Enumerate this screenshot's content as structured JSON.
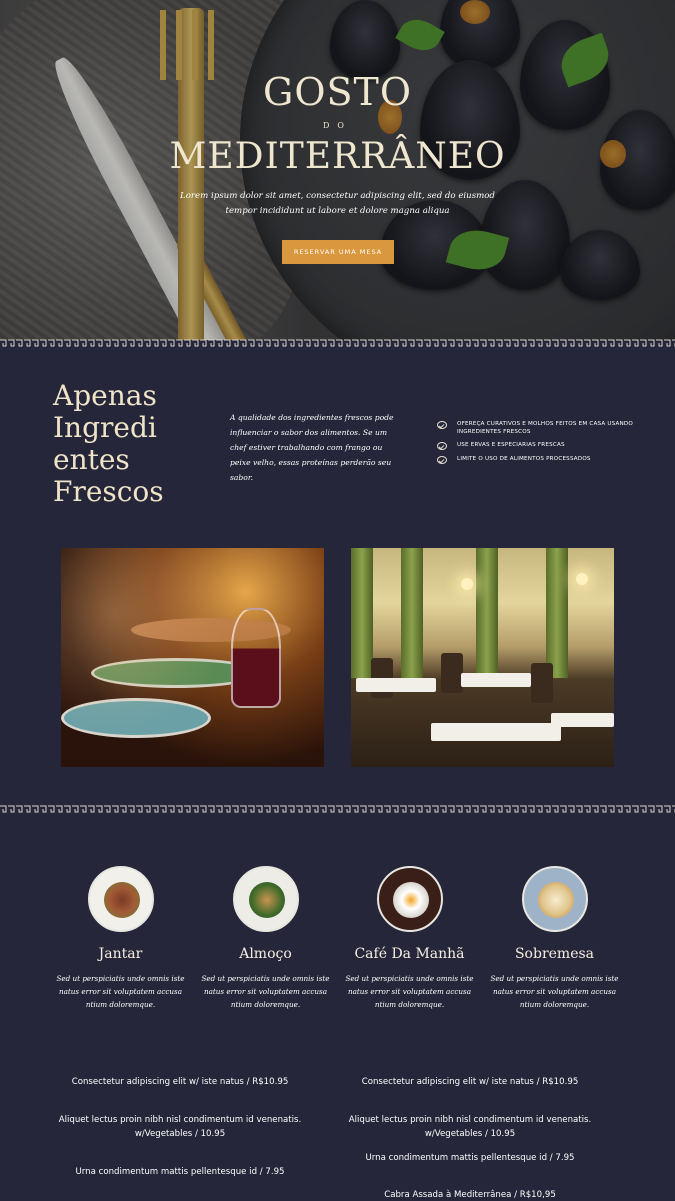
{
  "hero": {
    "title_line1": "GOSTO",
    "title_line2": "DO",
    "title_line3": "MEDITERRÂNEO",
    "subtitle": "Lorem ipsum dolor sit amet, consectetur adipiscing elit, sed do eiusmod tempor incididunt ut labore et dolore magna aliqua",
    "cta_label": "RESERVAR UMA MESA",
    "cta_color": "#d9973e"
  },
  "fresh": {
    "heading": "Apenas Ingredi entes Frescos",
    "description": "A qualidade dos ingredientes frescos pode influenciar o sabor dos alimentos. Se um chef estiver trabalhando com frango ou peixe velho, essas proteínas perderão seu sabor.",
    "bullets": [
      "OFEREÇA CURATIVOS E MOLHOS FEITOS EM CASA USANDO INGREDIENTES FRESCOS",
      "USE ERVAS E ESPECIARIAS FRESCAS",
      "LIMITE O USO DE ALIMENTOS PROCESSADOS"
    ]
  },
  "categories": [
    {
      "name": "Jantar",
      "description": "Sed ut perspiciatis unde omnis iste natus error sit voluptatem accusa ntium doloremque.",
      "icon": "dinner-plate-icon"
    },
    {
      "name": "Almoço",
      "description": "Sed ut perspiciatis unde omnis iste natus error sit voluptatem accusa ntium doloremque.",
      "icon": "lunch-plate-icon"
    },
    {
      "name": "Café Da Manhã",
      "description": "Sed ut perspiciatis unde omnis iste natus error sit voluptatem accusa ntium doloremque.",
      "icon": "breakfast-plate-icon"
    },
    {
      "name": "Sobremesa",
      "description": "Sed ut perspiciatis unde omnis iste natus error sit voluptatem accusa ntium doloremque.",
      "icon": "dessert-plate-icon"
    }
  ],
  "menu": {
    "left": [
      "Consectetur adipiscing elit w/ iste natus / R$10.95",
      "Aliquet lectus proin nibh nisl condimentum id venenatis. w/Vegetables / 10.95",
      "Urna condimentum mattis pellentesque id / 7.95"
    ],
    "right": [
      "Consectetur adipiscing elit w/ iste natus / R$10.95",
      "Aliquet lectus proin nibh nisl condimentum id venenatis. w/Vegetables / 10.95",
      "Urna condimentum mattis pellentesque id / 7.95",
      "Cabra Assada à Mediterrânea / R$10,95"
    ]
  },
  "colors": {
    "background": "#26263a",
    "accent": "#d9973e",
    "heading": "#efe3c8"
  }
}
